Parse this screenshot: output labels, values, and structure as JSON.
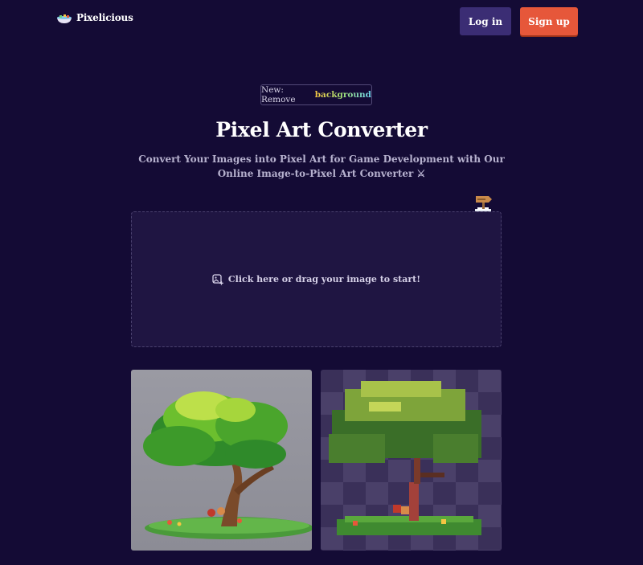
{
  "header": {
    "logo_text": "Pixelicious",
    "login_label": "Log in",
    "signup_label": "Sign up"
  },
  "badge": {
    "prefix": "New: Remove",
    "highlight": "background"
  },
  "hero": {
    "title": "Pixel Art Converter",
    "subtitle": "Convert Your Images into Pixel Art for Game Development with Our Online Image-to-Pixel Art Converter ⚔"
  },
  "dropzone": {
    "label": "Click here or drag your image to start!",
    "icon": "image-add-icon"
  },
  "examples": {
    "original_icon": "tree-illustration",
    "pixel_icon": "pixel-tree-illustration"
  },
  "colors": {
    "background": "#140b35",
    "login_button": "#3b2d74",
    "signup_button": "#e6573a",
    "dropzone": "#1f1542"
  }
}
